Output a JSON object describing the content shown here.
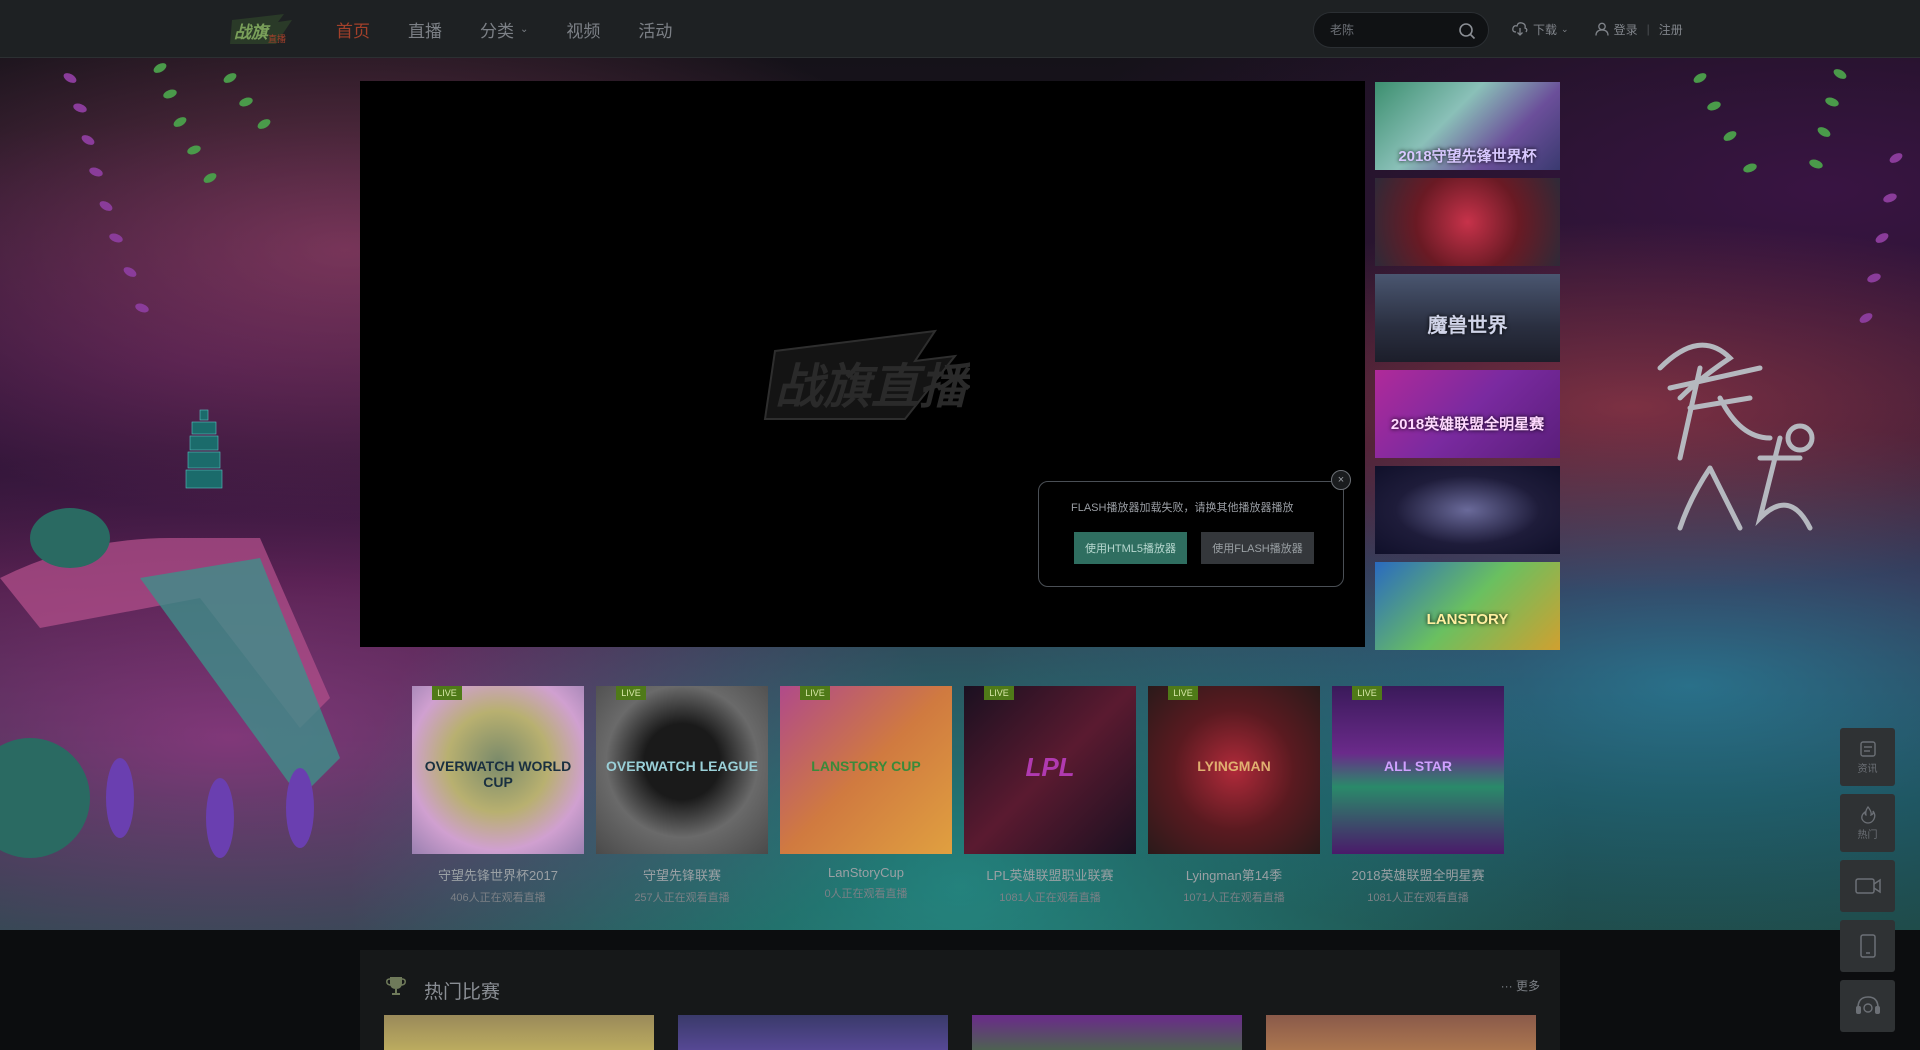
{
  "nav": {
    "logo": "战旗直播",
    "items": [
      {
        "label": "首页",
        "active": true
      },
      {
        "label": "直播",
        "active": false
      },
      {
        "label": "分类",
        "active": false,
        "dropdown": true
      },
      {
        "label": "视频",
        "active": false
      },
      {
        "label": "活动",
        "active": false
      }
    ],
    "search_placeholder": "老陈",
    "download": "下载",
    "login": "登录",
    "register": "注册"
  },
  "player": {
    "logo": "战旗直播",
    "flash_message": "FLASH播放器加载失败，请换其他播放器播放",
    "html5_button": "使用HTML5播放器",
    "flash_button": "使用FLASH播放器",
    "close": "×"
  },
  "side_thumbs": [
    {
      "caption": "2018守望先锋世界杯"
    },
    {
      "caption": ""
    },
    {
      "caption": "魔兽世界"
    },
    {
      "caption": "2018英雄联盟全明星赛"
    },
    {
      "caption": ""
    },
    {
      "caption": "LANSTORY"
    }
  ],
  "live_badge": "LIVE",
  "live_cards": [
    {
      "title": "守望先锋世界杯2017",
      "views": "406人正在观看直播",
      "thumb_text": "OVERWATCH WORLD CUP"
    },
    {
      "title": "守望先锋联赛",
      "views": "257人正在观看直播",
      "thumb_text": "OVERWATCH LEAGUE"
    },
    {
      "title": "LanStoryCup",
      "views": "0人正在观看直播",
      "thumb_text": "LANSTORY CUP"
    },
    {
      "title": "LPL英雄联盟职业联赛",
      "views": "1081人正在观看直播",
      "thumb_text": "LPL"
    },
    {
      "title": "Lyingman第14季",
      "views": "1071人正在观看直播",
      "thumb_text": "LYINGMAN"
    },
    {
      "title": "2018英雄联盟全明星赛",
      "views": "1081人正在观看直播",
      "thumb_text": "ALL STAR"
    }
  ],
  "hot": {
    "title": "热门比赛",
    "more": "··· 更多"
  },
  "float_menu": [
    {
      "label": "资讯",
      "icon": "news-icon"
    },
    {
      "label": "热门",
      "icon": "fire-icon"
    },
    {
      "label": "",
      "icon": "video-icon"
    },
    {
      "label": "",
      "icon": "mobile-icon"
    },
    {
      "label": "",
      "icon": "headset-icon"
    }
  ],
  "colors": {
    "active_nav": "#a3402a",
    "live_badge": "#4f7a18",
    "html5_button": "#2f6e60"
  }
}
